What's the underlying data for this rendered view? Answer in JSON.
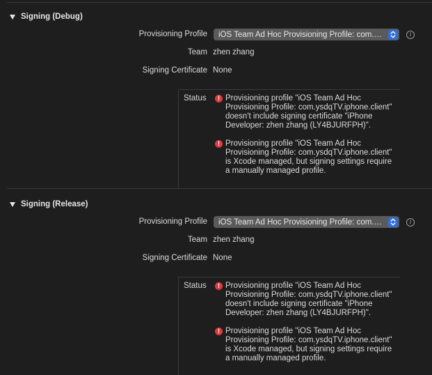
{
  "sections": [
    {
      "title": "Signing (Debug)",
      "provisioning_profile_label": "Provisioning Profile",
      "provisioning_profile_value": "iOS Team Ad Hoc Provisioning Profile: com.ysdqTV.iphone.client",
      "team_label": "Team",
      "team_value": "zhen zhang",
      "signing_certificate_label": "Signing Certificate",
      "signing_certificate_value": "None",
      "status_label": "Status",
      "errors": [
        "Provisioning profile \"iOS Team Ad Hoc\nProvisioning Profile: com.ysdqTV.iphone.client\"\ndoesn't include signing certificate \"iPhone\nDeveloper: zhen zhang (LY4BJURFPH)\".",
        "Provisioning profile \"iOS Team Ad Hoc\nProvisioning Profile: com.ysdqTV.iphone.client\"\nis Xcode managed, but signing settings require\na manually managed profile."
      ]
    },
    {
      "title": "Signing (Release)",
      "provisioning_profile_label": "Provisioning Profile",
      "provisioning_profile_value": "iOS Team Ad Hoc Provisioning Profile: com.ysdqTV.iphone.client",
      "team_label": "Team",
      "team_value": "zhen zhang",
      "signing_certificate_label": "Signing Certificate",
      "signing_certificate_value": "None",
      "status_label": "Status",
      "errors": [
        "Provisioning profile \"iOS Team Ad Hoc\nProvisioning Profile: com.ysdqTV.iphone.client\"\ndoesn't include signing certificate \"iPhone\nDeveloper: zhen zhang (LY4BJURFPH)\".",
        "Provisioning profile \"iOS Team Ad Hoc\nProvisioning Profile: com.ysdqTV.iphone.client\"\nis Xcode managed, but signing settings require\na manually managed profile."
      ]
    }
  ],
  "icons": {
    "disclosure": "disclosure-triangle-down-icon",
    "popup_stepper": "chevron-up-down-icon",
    "info": "info-circle-icon",
    "error": "error-exclamation-icon"
  },
  "colors": {
    "background": "#1e1e1e",
    "accent": "#2f6fdd",
    "error": "#e0393e",
    "popup": "#5a5a5a"
  }
}
